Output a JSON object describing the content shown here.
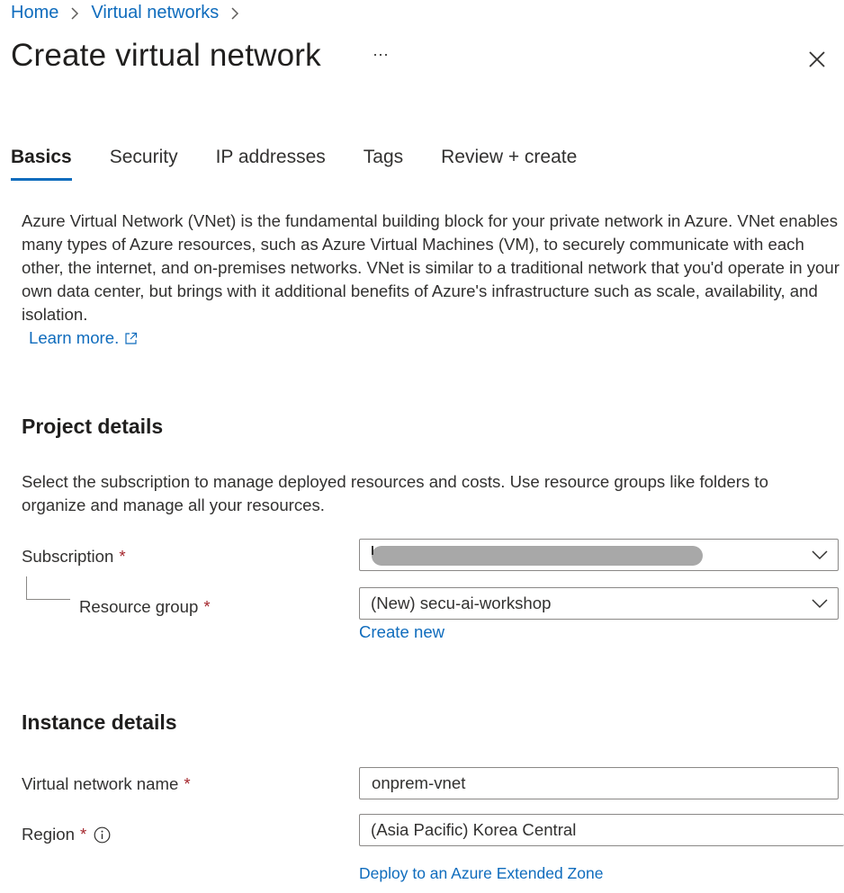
{
  "breadcrumb": [
    {
      "label": "Home"
    },
    {
      "label": "Virtual networks"
    }
  ],
  "page_title": "Create virtual network",
  "more_label": "···",
  "tabs": [
    {
      "label": "Basics",
      "active": true
    },
    {
      "label": "Security",
      "active": false
    },
    {
      "label": "IP addresses",
      "active": false
    },
    {
      "label": "Tags",
      "active": false
    },
    {
      "label": "Review + create",
      "active": false
    }
  ],
  "intro": {
    "text": "Azure Virtual Network (VNet) is the fundamental building block for your private network in Azure. VNet enables many types of Azure resources, such as Azure Virtual Machines (VM), to securely communicate with each other, the internet, and on-premises networks. VNet is similar to a traditional network that you'd operate in your own data center, but brings with it additional benefits of Azure's infrastructure such as scale, availability, and isolation.",
    "learn_more": "Learn more."
  },
  "project_details": {
    "heading": "Project details",
    "description": "Select the subscription to manage deployed resources and costs. Use resource groups like folders to organize and manage all your resources.",
    "subscription_label": "Subscription",
    "subscription_value": "",
    "resource_group_label": "Resource group",
    "resource_group_value": "(New) secu-ai-workshop",
    "create_new": "Create new"
  },
  "instance_details": {
    "heading": "Instance details",
    "vnet_name_label": "Virtual network name",
    "vnet_name_value": "onprem-vnet",
    "region_label": "Region",
    "region_value": "(Asia Pacific) Korea Central",
    "extended_zone_link": "Deploy to an Azure Extended Zone"
  },
  "required_marker": "*",
  "colors": {
    "link": "#0f6cbd",
    "required": "#a4262c",
    "text": "#323130",
    "border": "#8a8886"
  }
}
